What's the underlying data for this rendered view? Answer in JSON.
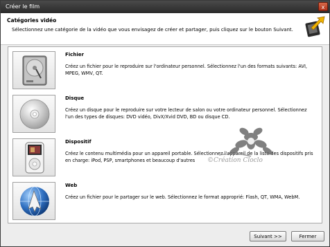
{
  "window": {
    "title": "Créer le film",
    "close_glyph": "x"
  },
  "header": {
    "title": "Catégories vidéo",
    "subtitle": "Sélectionnez une catégorie de la vidéo que vous envisagez de créer et partager, puis cliquez sur le bouton Suivant.",
    "icon": "film-export-icon"
  },
  "options": [
    {
      "title": "Fichier",
      "description": "Créez un fichier pour le reproduire sur l'ordinateur personnel. Sélectionnez l'un des formats suivants: AVI, MPEG, WMV, QT.",
      "icon": "hard-drive-icon"
    },
    {
      "title": "Disque",
      "description": "Créez un disque pour le reproduire sur votre lecteur de salon ou votre ordinateur personnel. Sélectionnez l'un des types de disques: DVD vidéo, DivX/Xvid DVD, BD ou disque CD.",
      "icon": "disc-icon"
    },
    {
      "title": "Dispositif",
      "description": "Créez le contenu multimédia pour un appareil portable. Sélectionnez l'appareil de la liste des dispositifs pris en charge: iPod, PSP, smartphones et beaucoup d'autres",
      "icon": "media-player-icon"
    },
    {
      "title": "Web",
      "description": "Créez un fichier pour le partager sur le web. Sélectionnez le format approprié: Flash, QT, WMA, WebM.",
      "icon": "globe-icon"
    }
  ],
  "watermark": {
    "text": "©Création Cloclo"
  },
  "buttons": {
    "next": "Suivant >>",
    "close": "Fermer"
  }
}
